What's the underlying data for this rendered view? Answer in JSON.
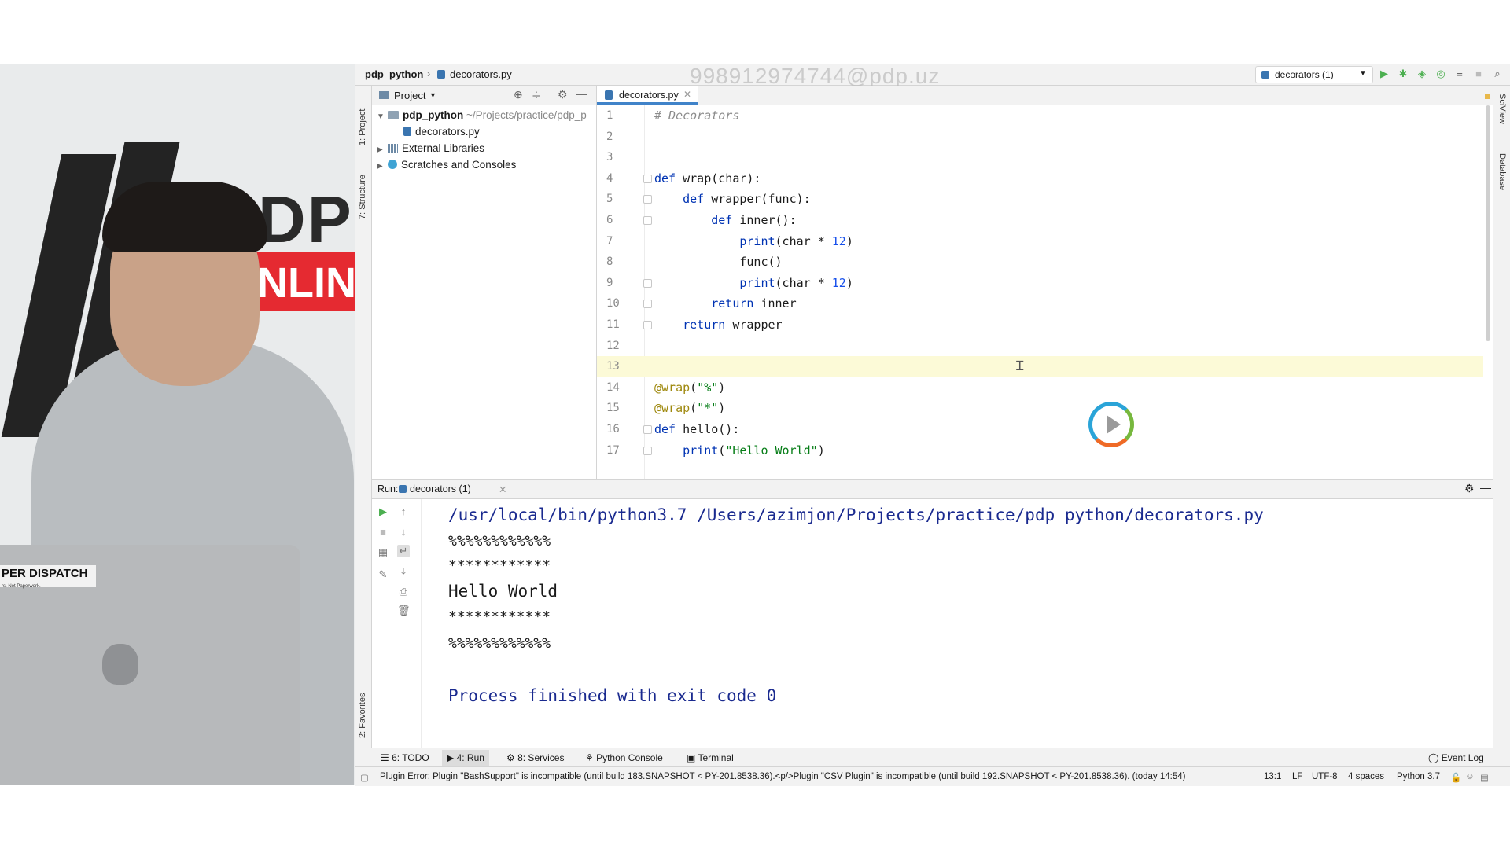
{
  "window": {
    "breadcrumb_project": "pdp_python",
    "breadcrumb_file": "decorators.py",
    "watermark": "998912974744@pdp.uz",
    "run_config": "decorators (1)"
  },
  "webcam": {
    "logo_text": "PDP",
    "logo_online": "ONLINE",
    "sticker": "PER DISPATCH",
    "sticker_sub": "rs. Not Paperwork."
  },
  "side_tabs": {
    "project": "1: Project",
    "structure": "7: Structure",
    "favorites": "2: Favorites",
    "sciview": "SciView",
    "database": "Database"
  },
  "project_panel": {
    "title": "Project",
    "items": [
      {
        "label": "pdp_python",
        "detail": "~/Projects/practice/pdp_p"
      },
      {
        "label": "decorators.py"
      },
      {
        "label": "External Libraries"
      },
      {
        "label": "Scratches and Consoles"
      }
    ]
  },
  "editor": {
    "tab_label": "decorators.py",
    "line_numbers": [
      "1",
      "2",
      "3",
      "4",
      "5",
      "6",
      "7",
      "8",
      "9",
      "10",
      "11",
      "12",
      "13",
      "14",
      "15",
      "16",
      "17"
    ],
    "current_line": "13"
  },
  "run_panel": {
    "label": "Run:",
    "tab": "decorators (1)",
    "output": [
      "/usr/local/bin/python3.7 /Users/azimjon/Projects/practice/pdp_python/decorators.py",
      "%%%%%%%%%%%%",
      "************",
      "Hello World",
      "************",
      "%%%%%%%%%%%%",
      "",
      "Process finished with exit code 0"
    ]
  },
  "bottom_tabs": {
    "todo": "6: TODO",
    "run": "4: Run",
    "services": "8: Services",
    "python_console": "Python Console",
    "terminal": "Terminal",
    "event_log": "Event Log"
  },
  "status": {
    "message": "Plugin Error: Plugin \"BashSupport\" is incompatible (until build 183.SNAPSHOT < PY-201.8538.36).<p/>Plugin \"CSV Plugin\" is incompatible (until build 192.SNAPSHOT < PY-201.8538.36). (today 14:54)",
    "position": "13:1",
    "line_sep": "LF",
    "encoding": "UTF-8",
    "indent": "4 spaces",
    "interpreter": "Python 3.7"
  },
  "colors": {
    "keyword": "#0033b3",
    "number": "#1750eb",
    "string": "#067d17",
    "output_blue": "#1a2a8f",
    "current_line": "#fcfad7",
    "run_green": "#4caf50"
  }
}
